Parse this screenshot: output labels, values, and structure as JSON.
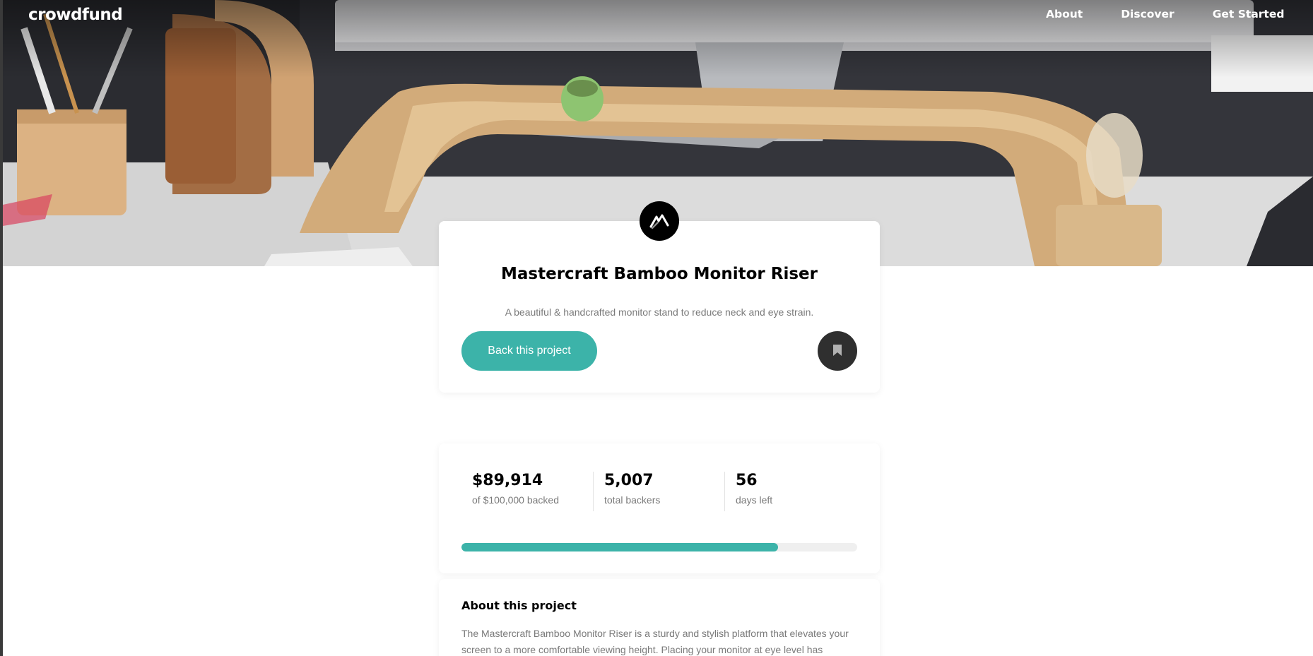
{
  "header": {
    "logo": "crowdfund",
    "nav": [
      "About",
      "Discover",
      "Get Started"
    ]
  },
  "project": {
    "title": "Mastercraft Bamboo Monitor Riser",
    "subtitle": "A beautiful & handcrafted monitor stand to reduce neck and eye strain.",
    "back_label": "Back this project",
    "brand_icon": "mastercraft-logo-icon",
    "bookmark_icon": "bookmark-icon"
  },
  "stats": {
    "backed": {
      "value": "$89,914",
      "label": "of $100,000 backed"
    },
    "backers": {
      "value": "5,007",
      "label": "total backers"
    },
    "days": {
      "value": "56",
      "label": "days left"
    },
    "progress": 0.8
  },
  "about": {
    "title": "About this project",
    "text": "The Mastercraft Bamboo Monitor Riser is a sturdy and stylish platform that elevates your screen to a more comfortable viewing height. Placing your monitor at eye level has"
  },
  "colors": {
    "accent": "#3cb3a9",
    "dark": "#2f2f2f",
    "muted_text": "#7a7a7a"
  }
}
